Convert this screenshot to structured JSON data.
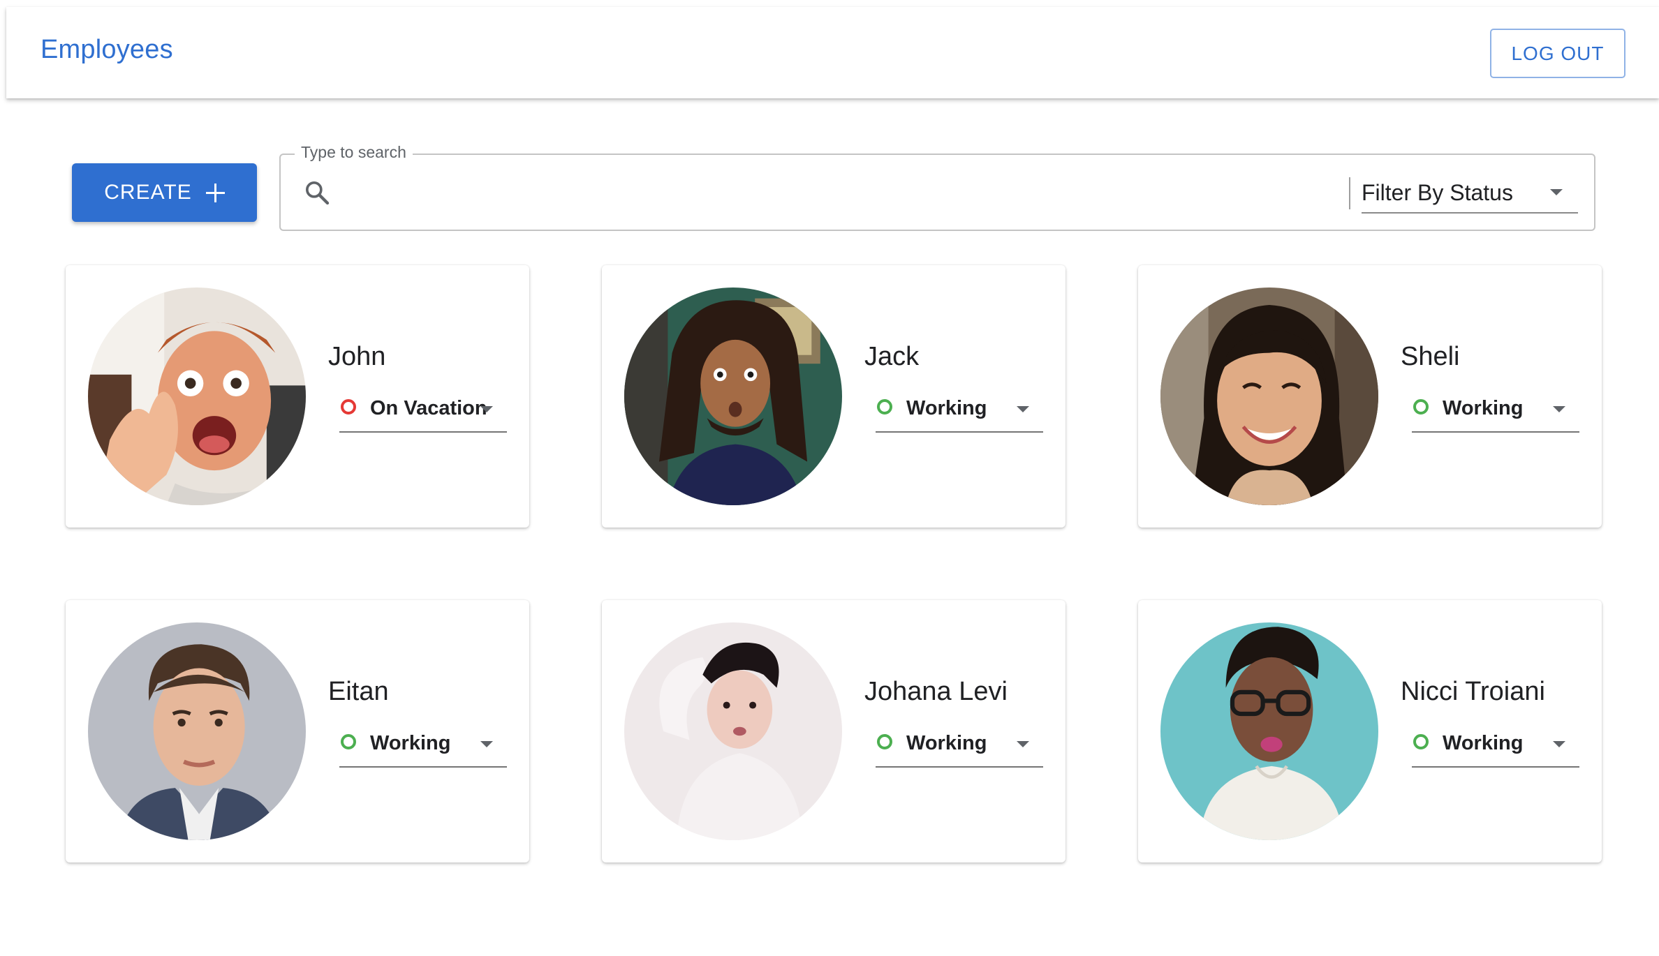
{
  "header": {
    "title": "Employees",
    "logout_label": "LOG OUT"
  },
  "toolbar": {
    "create_label": "CREATE",
    "create_icon": "plus-icon",
    "search": {
      "legend": "Type to search",
      "value": "",
      "icon": "search-icon"
    },
    "filter": {
      "label": "Filter By Status"
    }
  },
  "status_colors": {
    "working": "#4caf50",
    "on_vacation": "#e53935"
  },
  "accent_color": "#2f6fd0",
  "employees": [
    {
      "name": "John",
      "status": "On Vacation"
    },
    {
      "name": "Jack",
      "status": "Working"
    },
    {
      "name": "Sheli",
      "status": "Working"
    },
    {
      "name": "Eitan",
      "status": "Working"
    },
    {
      "name": "Johana Levi",
      "status": "Working"
    },
    {
      "name": "Nicci Troiani",
      "status": "Working"
    }
  ]
}
